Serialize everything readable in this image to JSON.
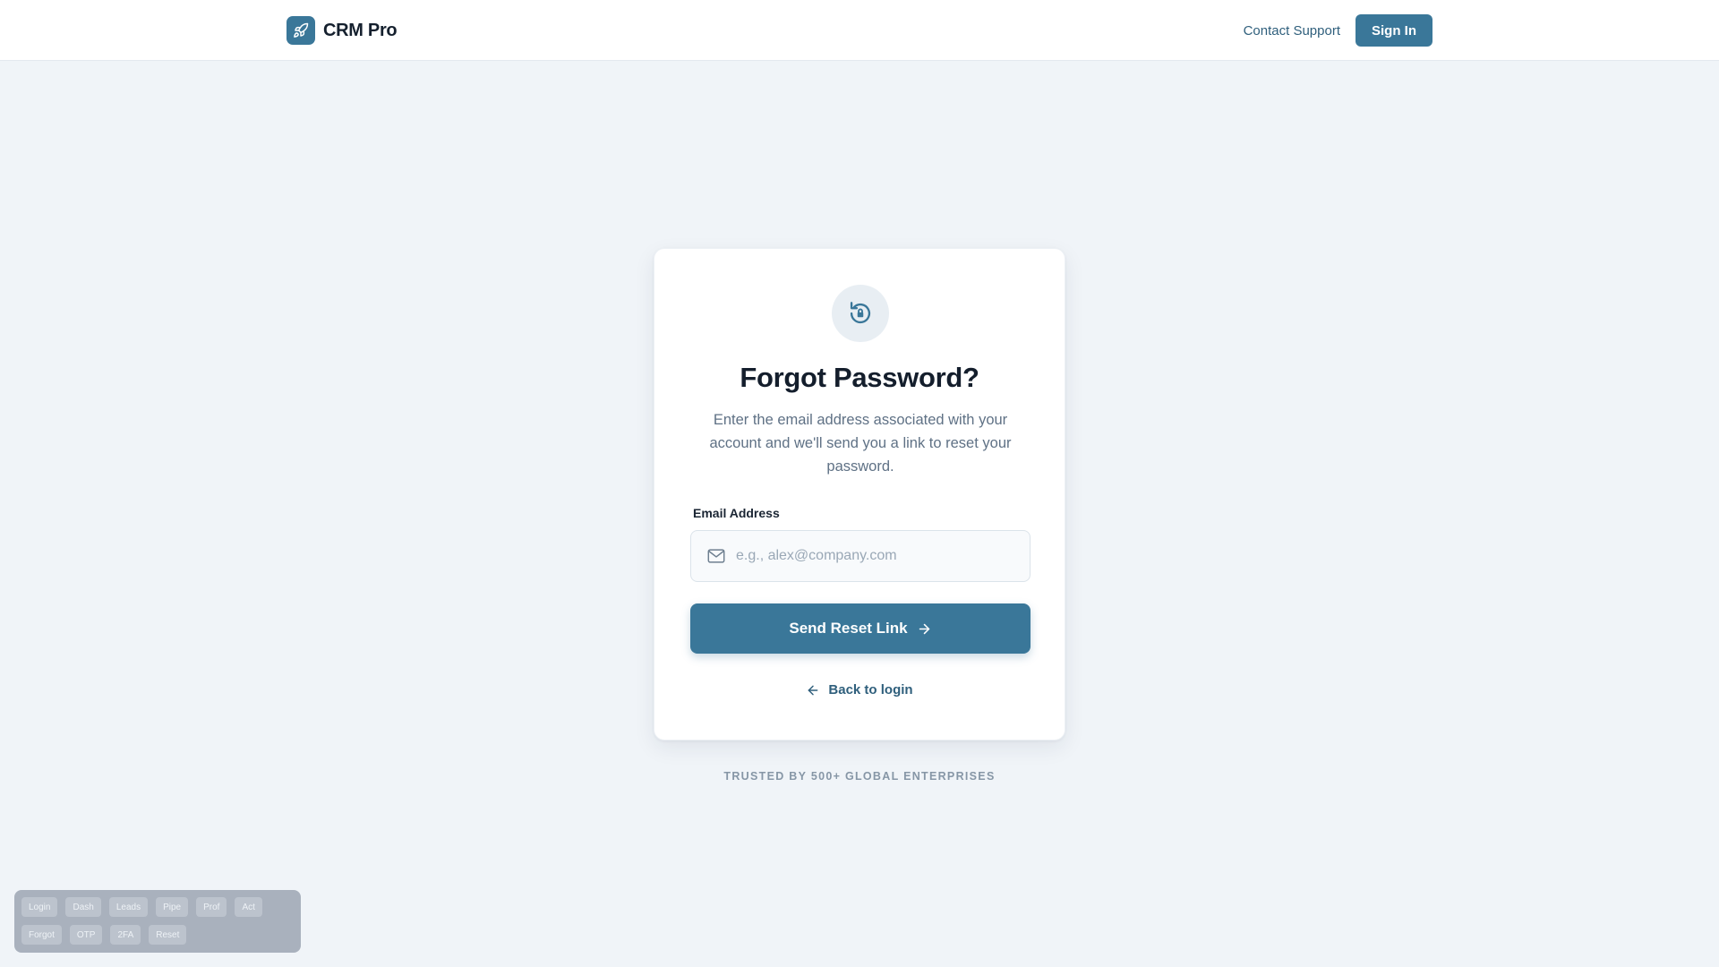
{
  "header": {
    "brand_name": "CRM Pro",
    "contact_label": "Contact Support",
    "signin_label": "Sign In"
  },
  "card": {
    "title": "Forgot Password?",
    "subtitle": "Enter the email address associated with your account and we'll send you a link to reset your password.",
    "email_label": "Email Address",
    "email_placeholder": "e.g., alex@company.com",
    "email_value": "",
    "submit_label": "Send Reset Link",
    "back_label": "Back to login"
  },
  "footer": {
    "trusted_text": "TRUSTED BY 500+ GLOBAL ENTERPRISES"
  },
  "dev_nav": {
    "row1": [
      "Login",
      "Dash",
      "Leads",
      "Pipe",
      "Prof",
      "Act"
    ],
    "row2": [
      "Forgot",
      "OTP",
      "2FA",
      "Reset"
    ]
  },
  "colors": {
    "primary": "#3a7799",
    "background": "#f0f4f8",
    "card": "#ffffff"
  },
  "icons": {
    "brand": "rocket-icon",
    "card": "lock-reset-icon",
    "input": "mail-icon",
    "submit": "arrow-right-icon",
    "back": "arrow-left-icon"
  }
}
